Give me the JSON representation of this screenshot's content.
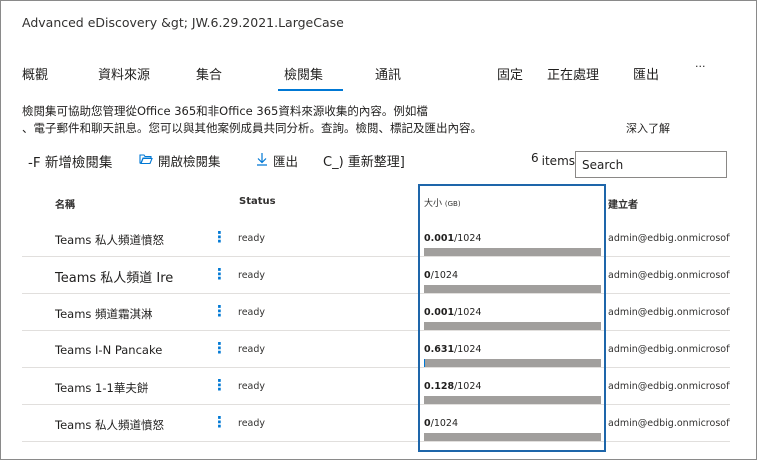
{
  "breadcrumb": "Advanced eDiscovery &gt; JW.6.29.2021.LargeCase",
  "tabs": [
    "概觀",
    "資料來源",
    "集合",
    "檢閱集",
    "通訊",
    "固定",
    "正在處理",
    "匯出",
    "···"
  ],
  "description": {
    "line1": "檢閱集可協助您管理從Office 365和非Office 365資料來源收集的內容。例如檔",
    "line2": "、電子郵件和聊天訊息。您可以與其他案例成員共同分析。查詢。檢閱、標記及匯出內容。",
    "learn_more": "深入了解"
  },
  "toolbar": {
    "new": "-F 新增檢閱集",
    "open": "開啟檢閱集",
    "open_icon": "folder-open-icon",
    "export": "匯出",
    "export_icon": "download-icon",
    "refresh": "C_) 重新整理]",
    "item_count_number": "6",
    "item_count_text": "items p",
    "search_placeholder": "Search"
  },
  "columns": {
    "name": "名稱",
    "status": "Status",
    "size": "大小",
    "size_unit": "(GB)",
    "creator": "建立者"
  },
  "rows": [
    {
      "name": "Teams 私人頻道憤怒",
      "status": "ready",
      "size_value": "0.001",
      "size_total": "/1024",
      "fraction": 1e-06,
      "creator": "admin@edbig.onmicrosoft.c"
    },
    {
      "name": "Teams 私人頻道 Ire",
      "status": "ready",
      "size_value": "0",
      "size_total": "/1024",
      "fraction": 0,
      "creator": "admin@edbig.onmicrosoft.c"
    },
    {
      "name": "Teams 頻道霜淇淋",
      "status": "ready",
      "size_value": "0.001",
      "size_total": "/1024",
      "fraction": 1e-06,
      "creator": "admin@edbig.onmicrosoft.c"
    },
    {
      "name": "Teams I-N Pancake",
      "status": "ready",
      "size_value": "0.631",
      "size_total": "/1024",
      "fraction": 0.0006,
      "creator": "admin@edbig.onmicrosoft.c"
    },
    {
      "name": "Teams 1-1華夫餅",
      "status": "ready",
      "size_value": "0.128",
      "size_total": "/1024",
      "fraction": 0.0001,
      "creator": "admin@edbig.onmicrosoft.c"
    },
    {
      "name": "Teams 私人頻道憤怒",
      "status": "ready",
      "size_value": "0",
      "size_total": "/1024",
      "fraction": 0,
      "creator": "admin@edbig.onmicrosoft.c"
    }
  ],
  "colors": {
    "accent": "#0078d4",
    "bar_track": "#a19f9d",
    "highlight_border": "#1e66aa"
  }
}
